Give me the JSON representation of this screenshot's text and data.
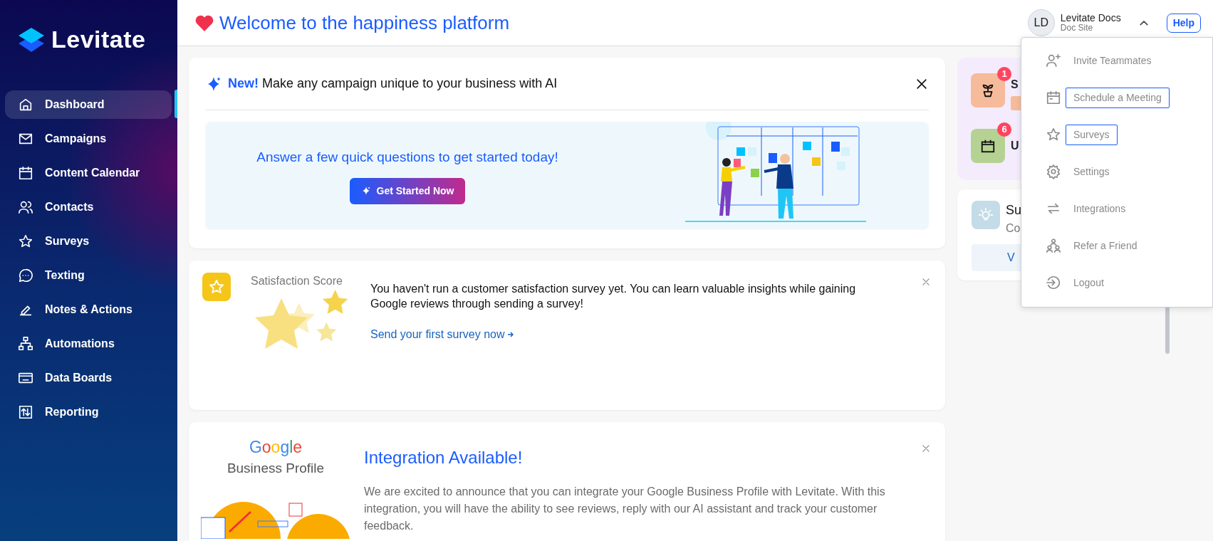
{
  "sidebar": {
    "logo": "Levitate",
    "items": [
      {
        "label": "Dashboard",
        "selected": true
      },
      {
        "label": "Campaigns",
        "selected": false
      },
      {
        "label": "Content Calendar",
        "selected": false
      },
      {
        "label": "Contacts",
        "selected": false
      },
      {
        "label": "Surveys",
        "selected": false
      },
      {
        "label": "Texting",
        "selected": false
      },
      {
        "label": "Notes & Actions",
        "selected": false
      },
      {
        "label": "Automations",
        "selected": false
      },
      {
        "label": "Data Boards",
        "selected": false
      },
      {
        "label": "Reporting",
        "selected": false
      }
    ]
  },
  "header": {
    "title": "Welcome to the happiness platform",
    "user": {
      "initials": "LD",
      "name": "Levitate Docs",
      "subtitle": "Doc Site"
    },
    "help": "Help"
  },
  "ai_card": {
    "badge": "New!",
    "headline": "Make any campaign unique to your business with AI",
    "prompt": "Answer a few quick questions to get started today!",
    "button": "Get Started Now"
  },
  "survey_card": {
    "title": "Satisfaction Score",
    "message": "You haven't run a customer satisfaction survey yet. You can learn valuable insights while gaining Google reviews through sending a survey!",
    "link": "Send your first survey now"
  },
  "integration_card": {
    "logo": "Google",
    "logo_subtitle": "Business Profile",
    "title": "Integration Available!",
    "message": "We are excited to announce that you can integrate your Google Business Profile with Levitate. With this integration, you will have the ability to see reviews, reply with our AI assistant and track your customer feedback."
  },
  "side_panel": {
    "tasks": [
      {
        "count": "1",
        "title": "S",
        "color": "#f6bb9b"
      },
      {
        "count": "6",
        "title": "U",
        "color": "#b5d292"
      }
    ],
    "tip": {
      "title": "Su",
      "subtitle": "Co",
      "button": "V"
    }
  },
  "user_menu": {
    "items": [
      {
        "label": "Invite Teammates",
        "focused": false
      },
      {
        "label": "Schedule a Meeting",
        "focused": true
      },
      {
        "label": "Surveys",
        "focused": true
      },
      {
        "label": "Settings",
        "focused": false
      },
      {
        "label": "Integrations",
        "focused": false
      },
      {
        "label": "Refer a Friend",
        "focused": false
      },
      {
        "label": "Logout",
        "focused": false
      }
    ]
  }
}
